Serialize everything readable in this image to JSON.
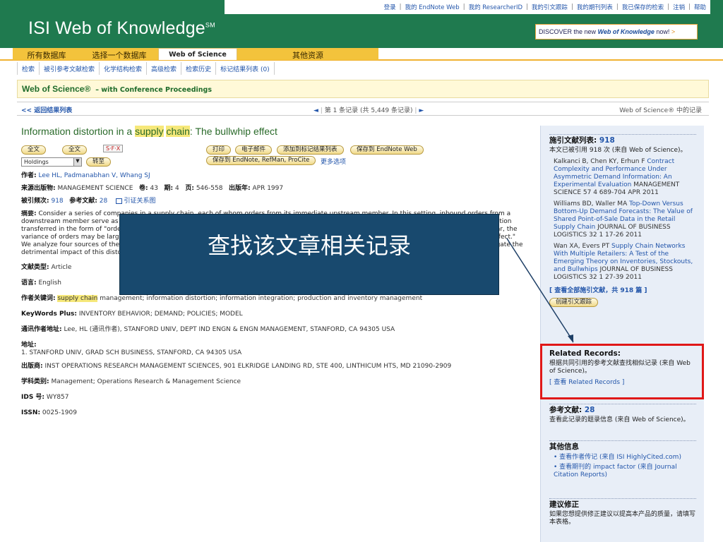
{
  "top_links": [
    "登录",
    "我的 EndNote Web",
    "我的 ResearcherID",
    "我的引文跟踪",
    "我的期刊列表",
    "我已保存的检索",
    "注销",
    "帮助"
  ],
  "logo": {
    "text": "ISI Web of Knowledge",
    "mark": "SM"
  },
  "discover": {
    "prefix": "DISCOVER the new ",
    "brand": "Web of Knowledge",
    "suffix": " now!",
    "arrow": ">"
  },
  "tabs": [
    "所有数据库",
    "选择一个数据库",
    "Web of Science",
    "其他资源"
  ],
  "subtabs": [
    "检索",
    "被引参考文献检索",
    "化学结构检索",
    "高级检索",
    "检索历史",
    "标记结果列表 (0)"
  ],
  "wos_bar": {
    "title": "Web of Science®",
    "subtitle": "– with Conference Proceedings"
  },
  "nav": {
    "back": "<< 返回结果列表",
    "left_arrow": "◄",
    "record": "第 1 条记录 (共 5,449 条记录)",
    "right_arrow": "►",
    "source": "Web of Science® 中的记录"
  },
  "article": {
    "title_pre": "Information distortion in a ",
    "title_hl1": "supply",
    "title_mid": " ",
    "title_hl2": "chain",
    "title_post": ": The bullwhip effect",
    "btn_fulltext1": "全文",
    "btn_fulltext2": "全文",
    "sfx": "S·F·X",
    "holdings": "Holdings",
    "goto": "转至",
    "actions": [
      "打印",
      "电子邮件",
      "添加到标记结果列表",
      "保存到 EndNote Web"
    ],
    "save_to": "保存到 EndNote, RefMan, ProCite",
    "more": "更多选项",
    "authors_label": "作者:",
    "authors": "Lee HL, Padmanabhan V, Whang SJ",
    "source_label": "来源出版物:",
    "source": "MANAGEMENT SCIENCE",
    "volume_label": "卷:",
    "volume": "43",
    "issue_label": "期:",
    "issue": "4",
    "pages_label": "页:",
    "pages": "546-558",
    "year_label": "出版年:",
    "year": "APR 1997",
    "cited_label": "被引频次:",
    "cited": "918",
    "refs_label": "参考文献:",
    "refs": "28",
    "citation_map": "引证关系图",
    "abstract_label": "摘要:",
    "abstract": "Consider a series of companies in a supply chain, each of whom orders from its immediate upstream member. In this setting, inbound orders from a downstream member serve as a valuable informational input to upstream production and replenishment decisions. This paper shows that the information transferred in the form of \"orders\" tends to be distorted and can misguide upstream members in their inventory and production decisions. In particular, the variance of orders may be larger than that of sales, and the distortion tends to increase as one moves upstream - a phenomenon termed \"bullwhip effect.\" We analyze four sources of the bullwhip effect: demand signal processing, rationing game, order batching, and price variations. Actions that can mitigate the detrimental impact of this distortion are also discussed.",
    "doctype_label": "文献类型:",
    "doctype": "Article",
    "language_label": "语言:",
    "language": "English",
    "keywords_label": "作者关键词:",
    "keywords_hl": "supply chain",
    "keywords": " management; information distortion; information integration; production and inventory management",
    "kwplus_label": "KeyWords Plus:",
    "kwplus": "INVENTORY BEHAVIOR; DEMAND; POLICIES; MODEL",
    "reprint_label": "通讯作者地址:",
    "reprint": "Lee, HL (通讯作者), STANFORD UNIV, DEPT IND ENGN & ENGN MANAGEMENT, STANFORD, CA 94305 USA",
    "address_label": "地址:",
    "address": "1. STANFORD UNIV, GRAD SCH BUSINESS, STANFORD, CA 94305 USA",
    "publisher_label": "出版商:",
    "publisher": "INST OPERATIONS RESEARCH MANAGEMENT SCIENCES, 901 ELKRIDGE LANDING RD, STE 400, LINTHICUM HTS, MD 21090-2909",
    "subject_label": "学科类别:",
    "subject": "Management; Operations Research & Management Science",
    "ids_label": "IDS 号:",
    "ids": "WY857",
    "issn_label": "ISSN:",
    "issn": "0025-1909"
  },
  "sidebar": {
    "citing_label": "施引文献列表:",
    "citing_count": "918",
    "citing_desc": "本文已被引用 918 次 (来自 Web of Science)。",
    "citations": [
      {
        "authors": "Kalkanci B, Chen KY, Erhun F",
        "title": "Contract Complexity and Performance Under Asymmetric Demand Information: An Experimental Evaluation",
        "source": "MANAGEMENT SCIENCE 57 4 689-704 APR 2011"
      },
      {
        "authors": "Williams BD, Waller MA",
        "title": "Top-Down Versus Bottom-Up Demand Forecasts: The Value of Shared Point-of-Sale Data in the Retail Supply Chain",
        "source": "JOURNAL OF BUSINESS LOGISTICS 32 1 17-26 2011"
      },
      {
        "authors": "Wan XA, Evers PT",
        "title": "Supply Chain Networks With Multiple Retailers: A Test of the Emerging Theory on Inventories, Stockouts, and Bullwhips",
        "source": "JOURNAL OF BUSINESS LOGISTICS 32 1 27-39 2011"
      }
    ],
    "view_all": "[ 查看全部施引文献，共 918 篇 ]",
    "create_alert": "创建引文跟踪",
    "related_title": "Related Records:",
    "related_desc": "根据共同引用的参考文献查找相似记录 (来自 Web of Science)。",
    "related_link": "[ 查看 Related Records ]",
    "refs_label": "参考文献:",
    "refs_count": "28",
    "refs_desc": "查看此记录的题录信息 (来自 Web of Science)。",
    "other_title": "其他信息",
    "other_items": [
      "查看作者传记 (来自 ISI HighlyCited.com)",
      "查看期刊的 impact factor (来自 Journal Citation Reports)"
    ],
    "suggest_title": "建议修正",
    "suggest_text": "如果您想提供修正建议以提高本产品的质量，请填写本表格。"
  },
  "overlay": {
    "text": "查找该文章相关记录"
  },
  "colors": {
    "header_green": "#1f7a4f",
    "tab_yellow": "#f3c33c",
    "overlay_blue": "#18496e",
    "highlight_red": "#e01818"
  }
}
